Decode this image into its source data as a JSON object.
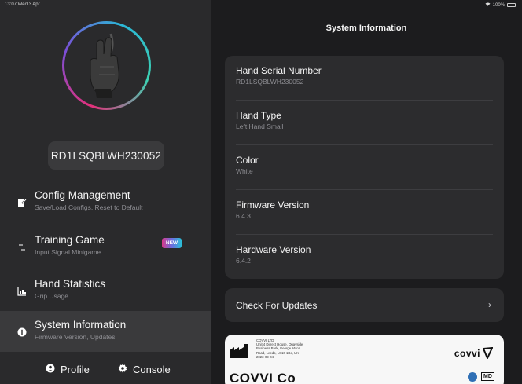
{
  "status_bar": {
    "time_date": "13:07  Wed 3 Apr",
    "battery": "100%"
  },
  "sidebar": {
    "serial": "RD1LSQBLWH230052",
    "items": [
      {
        "title": "Config Management",
        "subtitle": "Save/Load Configs, Reset to Default",
        "icon": "config-icon"
      },
      {
        "title": "Training Game",
        "subtitle": "Input Signal Minigame",
        "icon": "game-icon",
        "badge": "NEW"
      },
      {
        "title": "Hand Statistics",
        "subtitle": "Grip Usage",
        "icon": "stats-icon"
      },
      {
        "title": "System Information",
        "subtitle": "Firmware Version, Updates",
        "icon": "info-icon",
        "active": true
      }
    ],
    "footer": {
      "profile": "Profile",
      "console": "Console"
    }
  },
  "main": {
    "title": "System Information",
    "rows": [
      {
        "label": "Hand Serial Number",
        "value": "RD1LSQBLWH230052"
      },
      {
        "label": "Hand Type",
        "value": "Left Hand Small"
      },
      {
        "label": "Color",
        "value": "White"
      },
      {
        "label": "Firmware Version",
        "value": "6.4.3"
      },
      {
        "label": "Hardware Version",
        "value": "6.4.2"
      }
    ],
    "check_updates": "Check For Updates",
    "label_card": {
      "manufacturer_lines": [
        "COVVI LTD",
        "Unit 4 Dirrect House, Quayside",
        "Business Park, George Mann",
        "Road, Leeds, LS10 1DJ, UK",
        "2023-09-04"
      ],
      "brand": "covvi",
      "product_name": "COVVI Co",
      "md": "MD"
    }
  },
  "colors": {
    "accent_pink": "#e3307a",
    "accent_cyan": "#2bb6d6",
    "background": "#1c1c1e",
    "card": "#2c2c2e"
  }
}
